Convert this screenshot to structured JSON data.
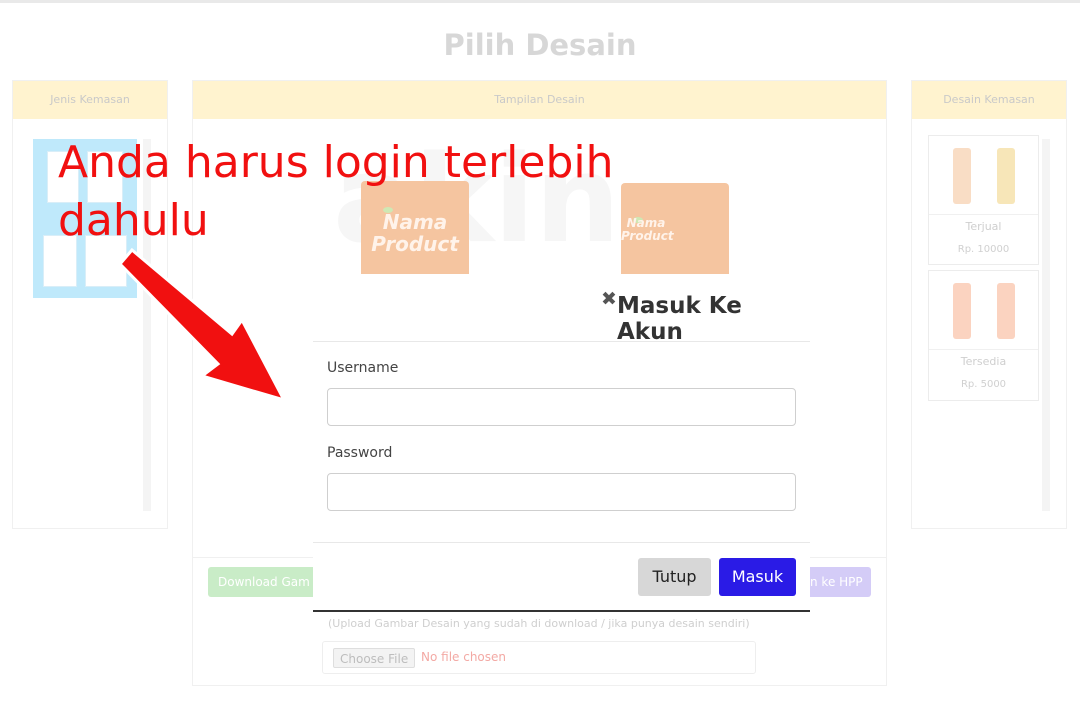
{
  "page": {
    "title": "Pilih Desain"
  },
  "panels": {
    "left_header": "Jenis Kemasan",
    "center_header": "Tampilan Desain",
    "right_header": "Desain Kemasan"
  },
  "preview": {
    "product_label": "Nama Product"
  },
  "designs": [
    {
      "name": "Terjual",
      "price": "Rp. 10000"
    },
    {
      "name": "Tersedia",
      "price": "Rp. 5000"
    }
  ],
  "actions": {
    "download_label": "Download Gam",
    "hpp_label": "n ke HPP"
  },
  "upload": {
    "hint": "(Upload Gambar Desain yang sudah di download / jika punya desain sendiri)",
    "choose_label": "Choose File",
    "no_file_label": "No file chosen"
  },
  "annotation": {
    "text_line1": "Anda harus login terlebih",
    "text_line2": "dahulu",
    "color": "#f11010"
  },
  "modal": {
    "close_icon": "✖",
    "title": "Masuk Ke Akun",
    "username_label": "Username",
    "username_value": "",
    "password_label": "Password",
    "password_value": "",
    "cancel_label": "Tutup",
    "submit_label": "Masuk",
    "submit_color": "#2a1be6"
  }
}
